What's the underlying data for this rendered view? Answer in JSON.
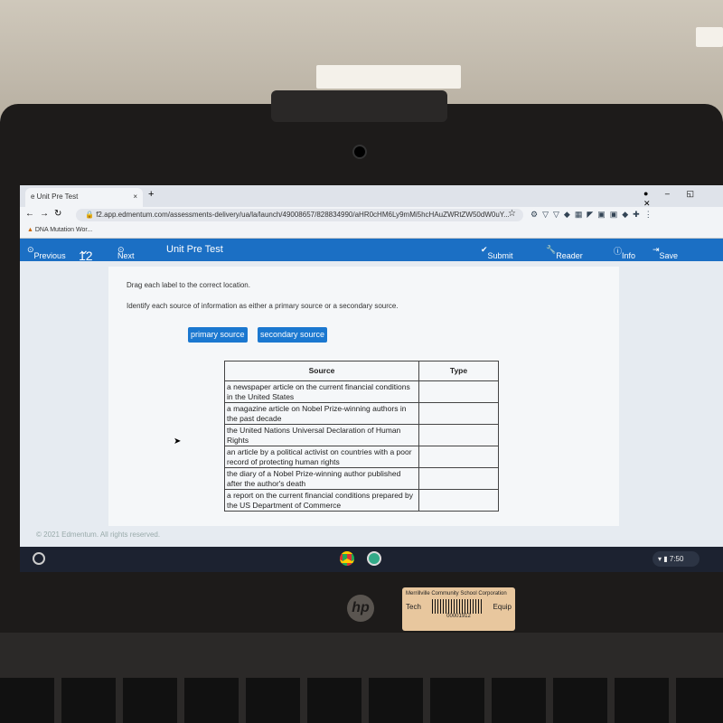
{
  "browser": {
    "tab_title": "Unit Pre Test",
    "url": "f2.app.edmentum.com/assessments-delivery/ua/la/launch/49008657/828834990/aHR0cHM6Ly9mMi5hcHAuZWRtZW50dW0uY...",
    "bookmark": "DNA Mutation Wor..."
  },
  "nav": {
    "previous": "Previous",
    "question_number": "12",
    "next": "Next",
    "title": "Unit Pre Test",
    "submit": "Submit Test",
    "reader_tools": "Reader Tools",
    "info": "Info",
    "save_exit": "Save & Exit"
  },
  "question": {
    "instruction": "Drag each label to the correct location.",
    "prompt": "Identify each source of information as either a primary source or a secondary source.",
    "labels": [
      "primary source",
      "secondary source"
    ],
    "headers": [
      "Source",
      "Type"
    ],
    "rows": [
      "a newspaper article on the current financial conditions in the United States",
      "a magazine article on Nobel Prize-winning authors in the past decade",
      "the United Nations Universal Declaration of Human Rights",
      "an article by a political activist on countries with a poor record of protecting human rights",
      "the diary of a Nobel Prize-winning author published after the author's death",
      "a report on the current financial conditions prepared by the US Department of Commerce"
    ]
  },
  "footer": "© 2021 Edmentum. All rights reserved.",
  "shelf": {
    "time": "7:50"
  },
  "sticker": {
    "org": "Merrillville Community School Corporation",
    "left": "Tech",
    "right": "Equip",
    "number": "00001912"
  },
  "colors": {
    "accent": "#1b6fc4",
    "chip": "#1b78d0"
  }
}
